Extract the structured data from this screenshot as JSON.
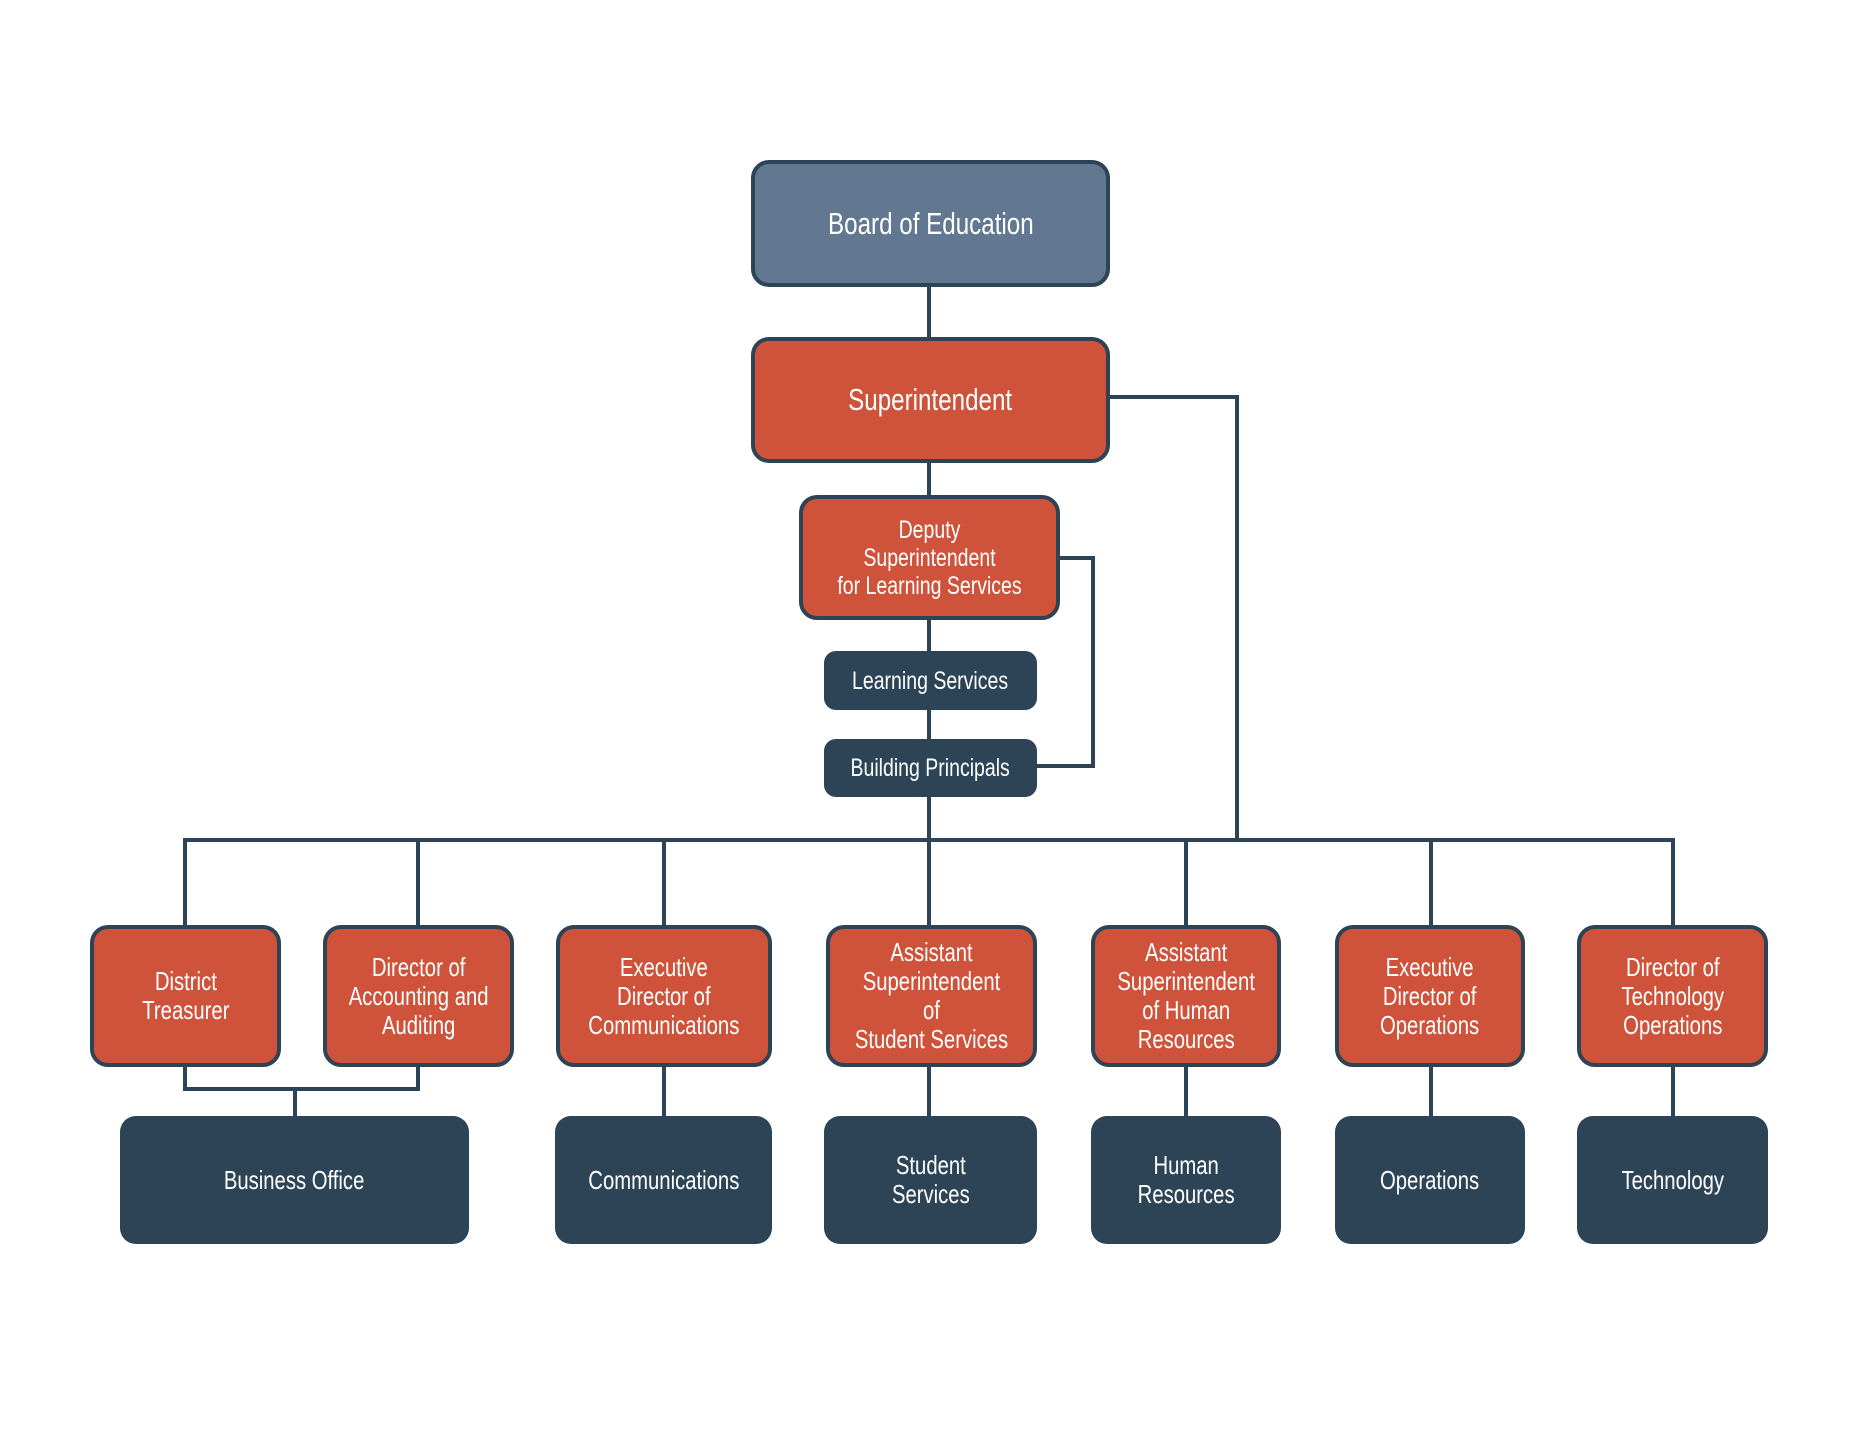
{
  "chart_data": {
    "type": "org-chart",
    "title": "",
    "colors": {
      "governance": "#627891",
      "leadership": "#CF523A",
      "department": "#2D4356",
      "connector": "#2D4356",
      "text": "#FFFFFF"
    },
    "nodes": [
      {
        "id": "board",
        "label": "Board of Education",
        "level": "governance",
        "reports_to": null
      },
      {
        "id": "superintendent",
        "label": "Superintendent",
        "level": "leadership",
        "reports_to": "board"
      },
      {
        "id": "deputy",
        "label": "Deputy Superintendent\nfor Learning Services",
        "level": "leadership",
        "reports_to": "superintendent"
      },
      {
        "id": "learning_services",
        "label": "Learning Services",
        "level": "department",
        "reports_to": "deputy"
      },
      {
        "id": "building_principals",
        "label": "Building Principals",
        "level": "department",
        "reports_to": "deputy"
      },
      {
        "id": "treasurer",
        "label": "District\nTreasurer",
        "level": "leadership",
        "reports_to": "superintendent"
      },
      {
        "id": "accounting",
        "label": "Director of\nAccounting and\nAuditing",
        "level": "leadership",
        "reports_to": "superintendent"
      },
      {
        "id": "exec_comm",
        "label": "Executive\nDirector of\nCommunications",
        "level": "leadership",
        "reports_to": "superintendent"
      },
      {
        "id": "asst_student",
        "label": "Assistant\nSuperintendent of\nStudent Services",
        "level": "leadership",
        "reports_to": "superintendent"
      },
      {
        "id": "asst_hr",
        "label": "Assistant\nSuperintendent\nof Human\nResources",
        "level": "leadership",
        "reports_to": "superintendent"
      },
      {
        "id": "exec_ops",
        "label": "Executive\nDirector of\nOperations",
        "level": "leadership",
        "reports_to": "superintendent"
      },
      {
        "id": "dir_tech",
        "label": "Director of\nTechnology\nOperations",
        "level": "leadership",
        "reports_to": "superintendent"
      },
      {
        "id": "business_office",
        "label": "Business Office",
        "level": "department",
        "reports_to": [
          "treasurer",
          "accounting"
        ]
      },
      {
        "id": "communications",
        "label": "Communications",
        "level": "department",
        "reports_to": "exec_comm"
      },
      {
        "id": "student_services",
        "label": "Student\nServices",
        "level": "department",
        "reports_to": "asst_student"
      },
      {
        "id": "human_resources",
        "label": "Human\nResources",
        "level": "department",
        "reports_to": "asst_hr"
      },
      {
        "id": "operations",
        "label": "Operations",
        "level": "department",
        "reports_to": "exec_ops"
      },
      {
        "id": "technology",
        "label": "Technology",
        "level": "department",
        "reports_to": "dir_tech"
      }
    ]
  }
}
